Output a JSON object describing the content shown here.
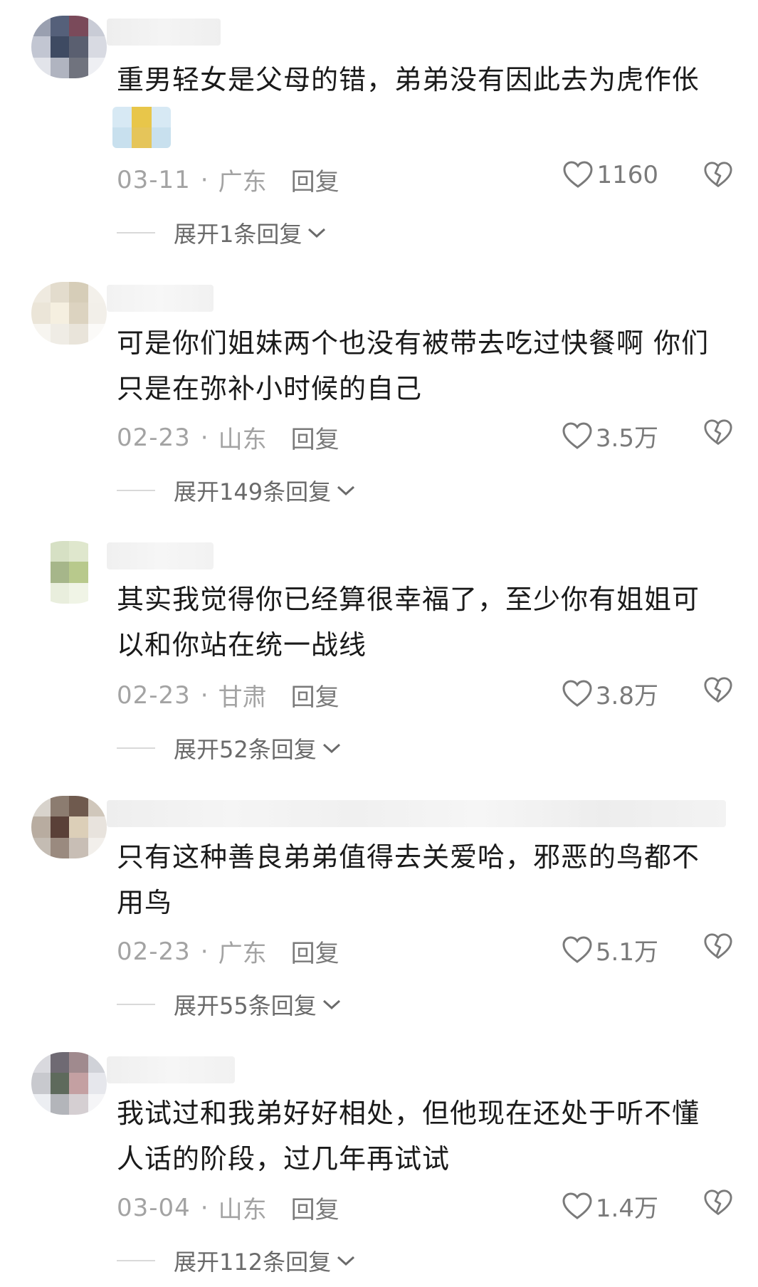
{
  "comments": [
    {
      "text": "重男轻女是父母的错，弟弟没有因此去为虎作伥",
      "date": "03-11",
      "dot": "·",
      "location": "广东",
      "reply_label": "回复",
      "likes": "1160",
      "expand_label": "展开1条回复",
      "avatar_colors": [
        "#9aa0b0",
        "#55607a",
        "#7a4a5a",
        "#c9ccd6",
        "#c2c6d2",
        "#3e4a62",
        "#5a5f70",
        "#d8dae2",
        "#e2e4ea",
        "#b0b4c0",
        "#70737e",
        "#eeeff3"
      ]
    },
    {
      "text": "可是你们姐妹两个也没有被带去吃过快餐啊 你们\n只是在弥补小时候的自己",
      "date": "02-23",
      "dot": "·",
      "location": "山东",
      "reply_label": "回复",
      "likes": "3.5万",
      "expand_label": "展开149条回复",
      "avatar_colors": [
        "#efeae0",
        "#e3dccd",
        "#d6cdb8",
        "#f3f0ea",
        "#ebe5d8",
        "#f5efe0",
        "#dcd3c0",
        "#f2efe9",
        "#f7f5f0",
        "#efece5",
        "#e9e4da",
        "#fbfaf8"
      ]
    },
    {
      "text": "其实我觉得你已经算很幸福了，至少你有姐姐可\n以和你站在统一战线",
      "date": "02-23",
      "dot": "·",
      "location": "甘肃",
      "reply_label": "回复",
      "likes": "3.8万",
      "expand_label": "展开52条回复",
      "avatar_colors": [
        "#ffffff",
        "#d6e0c4",
        "#dfe7cd",
        "#ffffff",
        "#ffffff",
        "#a6b68a",
        "#b8c98c",
        "#ffffff",
        "#ffffff",
        "#e9eedd",
        "#f0f4e6",
        "#ffffff"
      ]
    },
    {
      "text": "只有这种善良弟弟值得去关爱哈，邪恶的鸟都不\n用鸟",
      "date": "02-23",
      "dot": "·",
      "location": "广东",
      "reply_label": "回复",
      "likes": "5.1万",
      "expand_label": "展开55条回复",
      "avatar_colors": [
        "#d8d3cc",
        "#8c7c70",
        "#6f5a4e",
        "#d0c7bb",
        "#b8aca0",
        "#5a4038",
        "#dccfb8",
        "#e8e3dd",
        "#c4bcb3",
        "#9a8a7f",
        "#c8beb5",
        "#f2efeb"
      ]
    },
    {
      "text": "我试过和我弟好好相处，但他现在还处于听不懂\n人话的阶段，过几年再试试",
      "date": "03-04",
      "dot": "·",
      "location": "山东",
      "reply_label": "回复",
      "likes": "1.4万",
      "expand_label": "展开112条回复",
      "avatar_colors": [
        "#d9d9de",
        "#6f6a73",
        "#a08a8e",
        "#d0d2d8",
        "#c8c9ce",
        "#5e6a5c",
        "#c4a0a2",
        "#e6e7ec",
        "#eceef2",
        "#b3b5ba",
        "#d5cfd2",
        "#f5f5f7"
      ]
    }
  ],
  "emoji_colors": [
    "#d7e9f4",
    "#e8c64a",
    "#d7e9f4",
    "#c8e0ee",
    "#e5c55a",
    "#c8e0ee"
  ]
}
